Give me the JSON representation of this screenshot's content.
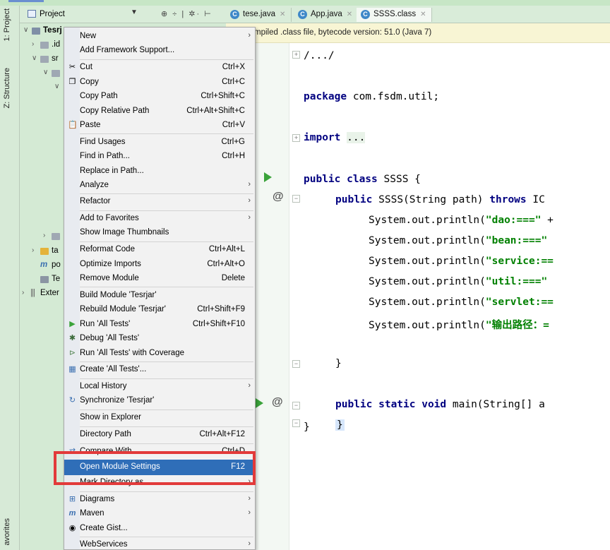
{
  "left_tool_window": {
    "tabs": [
      "1: Project",
      "Z: Structure",
      "avorites"
    ]
  },
  "project_panel": {
    "title": "Project",
    "tree": [
      {
        "label": "Tesrj",
        "bold": true
      },
      {
        "label": ".id"
      },
      {
        "label": "sr"
      },
      {
        "label": ""
      },
      {
        "label": ""
      },
      {
        "label": ""
      },
      {
        "label": "ta"
      },
      {
        "label": "po"
      },
      {
        "label": "Te"
      },
      {
        "label": "Exter"
      }
    ]
  },
  "editor_tabs": [
    {
      "label": "tese.java",
      "active": false
    },
    {
      "label": "App.java",
      "active": false
    },
    {
      "label": "SSSS.class",
      "active": true
    }
  ],
  "banner": {
    "text": "mpiled .class file, bytecode version: 51.0 (Java 7)"
  },
  "code_lines": [
    "/.../",
    "package com.fsdm.util;",
    "import ...",
    "public class SSSS {",
    "public SSSS(String path) throws IC",
    "System.out.println(\"dao:===\" +",
    "System.out.println(\"bean:===\"",
    "System.out.println(\"service:==",
    "System.out.println(\"util:===\"",
    "System.out.println(\"servlet:==",
    "System.out.println(\"输出路径：=",
    "}",
    "public static void main(String[] a",
    "}",
    "}"
  ],
  "context_menu": {
    "items": [
      {
        "label": "New",
        "submenu": true
      },
      {
        "label": "Add Framework Support..."
      },
      {
        "label": "Cut",
        "shortcut": "Ctrl+X",
        "icon": "scissors-icon"
      },
      {
        "label": "Copy",
        "shortcut": "Ctrl+C",
        "icon": "copy-icon"
      },
      {
        "label": "Copy Path",
        "shortcut": "Ctrl+Shift+C"
      },
      {
        "label": "Copy Relative Path",
        "shortcut": "Ctrl+Alt+Shift+C"
      },
      {
        "label": "Paste",
        "shortcut": "Ctrl+V",
        "icon": "paste-icon"
      },
      {
        "label": "Find Usages",
        "shortcut": "Ctrl+G"
      },
      {
        "label": "Find in Path...",
        "shortcut": "Ctrl+H"
      },
      {
        "label": "Replace in Path..."
      },
      {
        "label": "Analyze",
        "submenu": true
      },
      {
        "label": "Refactor",
        "submenu": true
      },
      {
        "label": "Add to Favorites",
        "submenu": true
      },
      {
        "label": "Show Image Thumbnails"
      },
      {
        "label": "Reformat Code",
        "shortcut": "Ctrl+Alt+L"
      },
      {
        "label": "Optimize Imports",
        "shortcut": "Ctrl+Alt+O"
      },
      {
        "label": "Remove Module",
        "shortcut": "Delete"
      },
      {
        "label": "Build Module 'Tesrjar'"
      },
      {
        "label": "Rebuild Module 'Tesrjar'",
        "shortcut": "Ctrl+Shift+F9"
      },
      {
        "label": "Run 'All Tests'",
        "shortcut": "Ctrl+Shift+F10",
        "icon": "run-icon"
      },
      {
        "label": "Debug 'All Tests'",
        "icon": "debug-icon"
      },
      {
        "label": "Run 'All Tests' with Coverage",
        "icon": "coverage-icon"
      },
      {
        "label": "Create 'All Tests'...",
        "icon": "create-test-icon"
      },
      {
        "label": "Local History",
        "submenu": true
      },
      {
        "label": "Synchronize 'Tesrjar'",
        "icon": "sync-icon"
      },
      {
        "label": "Show in Explorer"
      },
      {
        "label": "Directory Path",
        "shortcut": "Ctrl+Alt+F12"
      },
      {
        "label": "Compare With...",
        "shortcut": "Ctrl+D",
        "icon": "compare-icon"
      },
      {
        "label": "Open Module Settings",
        "shortcut": "F12",
        "selected": true
      },
      {
        "label": "Mark Directory as",
        "submenu": true
      },
      {
        "label": "Diagrams",
        "submenu": true,
        "icon": "diagram-icon"
      },
      {
        "label": "Maven",
        "submenu": true,
        "icon": "maven-icon"
      },
      {
        "label": "Create Gist...",
        "icon": "github-icon"
      },
      {
        "label": "WebServices",
        "submenu": true
      }
    ]
  },
  "colors": {
    "selection": "#2f6eb8",
    "highlight_box": "#e23a3a",
    "keyword": "#000080",
    "string": "#008000",
    "run_gutter": "#3aa33a"
  }
}
